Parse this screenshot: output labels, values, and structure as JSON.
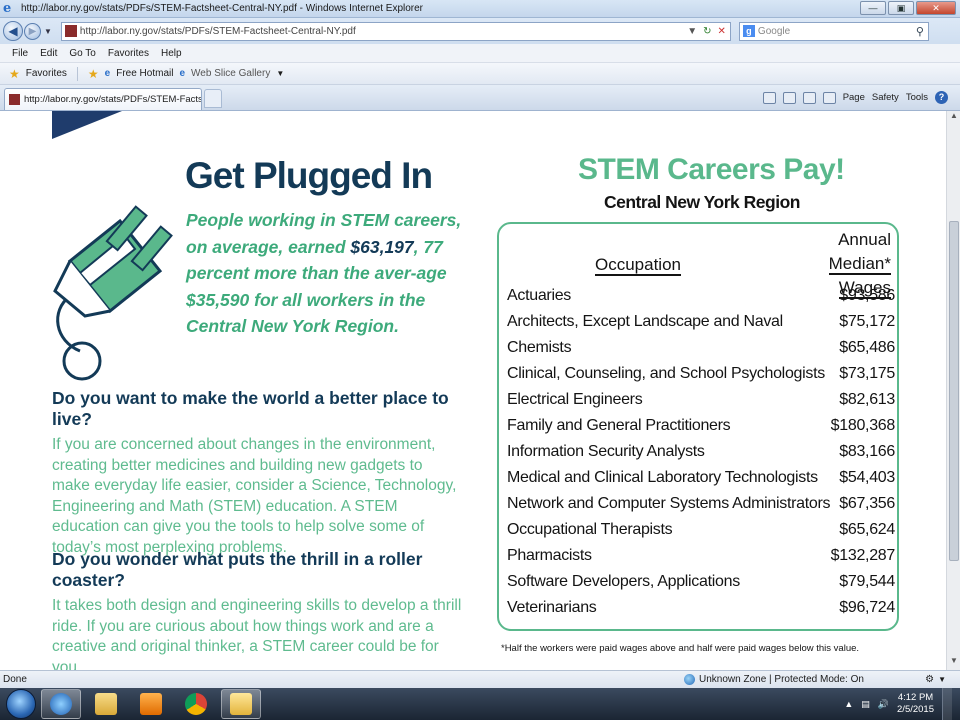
{
  "window": {
    "title": "http://labor.ny.gov/stats/PDFs/STEM-Factsheet-Central-NY.pdf - Windows Internet Explorer"
  },
  "address": {
    "url": "http://labor.ny.gov/stats/PDFs/STEM-Factsheet-Central-NY.pdf",
    "search_placeholder": "Google"
  },
  "menu": [
    "File",
    "Edit",
    "Go To",
    "Favorites",
    "Help"
  ],
  "favorites_bar": {
    "favorites_label": "Favorites",
    "free_hotmail": "Free Hotmail",
    "web_slice": "Web Slice Gallery"
  },
  "tab": {
    "label": "http://labor.ny.gov/stats/PDFs/STEM-Factsheet-..."
  },
  "command_bar": {
    "page": "Page",
    "safety": "Safety",
    "tools": "Tools"
  },
  "doc": {
    "plug_title": "Get Plugged In",
    "plug_text_1": "People working in STEM careers, on average, earned ",
    "plug_amount": "$63,197",
    "plug_text_2": ", 77 percent more than the aver-age $35,590 for all workers in the Central New York Region.",
    "q1": "Do you want to make the world a better place to live?",
    "a1": "If you are concerned about changes in the environment, creating better medicines and building new gadgets to make everyday life easier, consider a Science, Technology, Engineering and  Math (STEM) education.  A STEM education can give you the tools to help solve some of today’s most perplexing problems.",
    "q2": "Do you wonder what puts the thrill in a roller coaster?",
    "a2": "It takes both design and engineering skills to develop a thrill ride. If you are curious about how things work and are a creative and original thinker, a STEM career could be for you.",
    "stem_title": "STEM Careers Pay!",
    "stem_sub": "Central New York Region",
    "col_occupation": "Occupation",
    "col_wage_1": "Annual",
    "col_wage_2": "Median* Wages",
    "rows": [
      {
        "occ": "Actuaries",
        "wage": "$93,586"
      },
      {
        "occ": "Architects, Except Landscape and Naval",
        "wage": "$75,172"
      },
      {
        "occ": "Chemists",
        "wage": "$65,486"
      },
      {
        "occ": "Clinical, Counseling, and School Psychologists",
        "wage": "$73,175"
      },
      {
        "occ": "Electrical Engineers",
        "wage": "$82,613"
      },
      {
        "occ": "Family and General Practitioners",
        "wage": "$180,368"
      },
      {
        "occ": "Information Security Analysts",
        "wage": "$83,166"
      },
      {
        "occ": "Medical and Clinical Laboratory Technologists",
        "wage": "$54,403"
      },
      {
        "occ": "Network and Computer Systems Administrators",
        "wage": "$67,356"
      },
      {
        "occ": "Occupational Therapists",
        "wage": "$65,624"
      },
      {
        "occ": "Pharmacists",
        "wage": "$132,287"
      },
      {
        "occ": "Software Developers, Applications",
        "wage": "$79,544"
      },
      {
        "occ": "Veterinarians",
        "wage": "$96,724"
      }
    ],
    "footnote": "*Half the workers were paid wages above and half were paid wages below this value."
  },
  "status": {
    "left": "Done",
    "zone": "Unknown Zone | Protected Mode: On"
  },
  "clock": {
    "time": "4:12 PM",
    "date": "2/5/2015"
  },
  "colors": {
    "navy": "#133a57",
    "green": "#5ab88c"
  }
}
